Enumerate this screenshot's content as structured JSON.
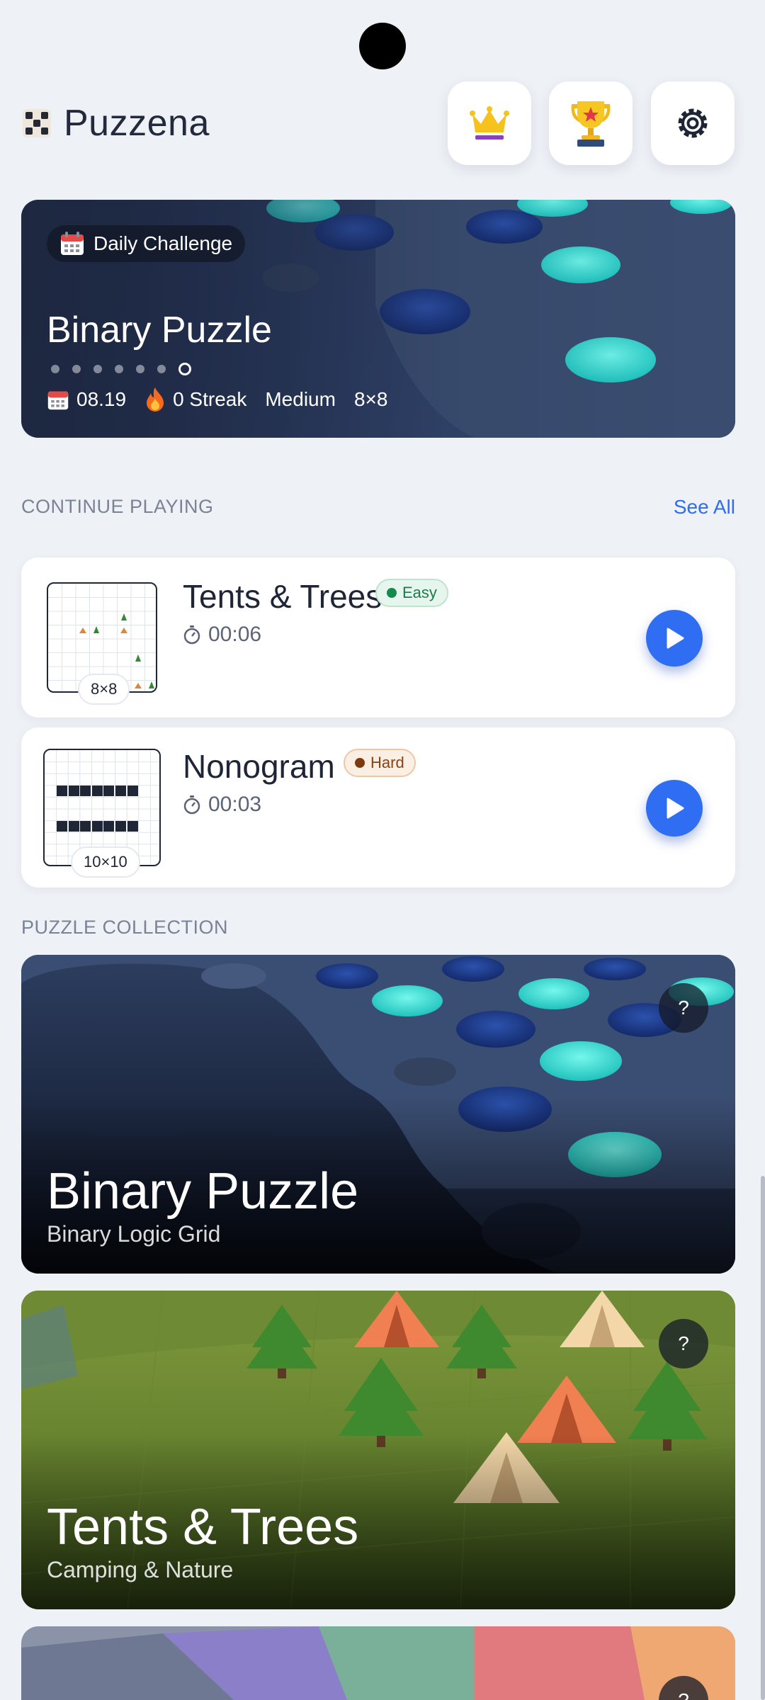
{
  "header": {
    "app_title": "Puzzena",
    "premium_icon": "crown-icon",
    "leaderboard_icon": "trophy-icon",
    "settings_icon": "gear-icon"
  },
  "daily_challenge": {
    "badge_label": "Daily Challenge",
    "puzzle_title": "Binary Puzzle",
    "carousel_count": 7,
    "carousel_active_index": 6,
    "date": "08.19",
    "streak": "0 Streak",
    "difficulty": "Medium",
    "grid_size": "8×8"
  },
  "continue_playing": {
    "heading": "CONTINUE PLAYING",
    "see_all": "See All",
    "items": [
      {
        "name": "Tents & Trees",
        "difficulty": "Easy",
        "time": "00:06",
        "size": "8×8"
      },
      {
        "name": "Nonogram",
        "difficulty": "Hard",
        "time": "00:03",
        "size": "10×10"
      }
    ]
  },
  "collection": {
    "heading": "PUZZLE COLLECTION",
    "help_label": "?",
    "items": [
      {
        "title": "Binary Puzzle",
        "subtitle": "Binary Logic Grid"
      },
      {
        "title": "Tents & Trees",
        "subtitle": "Camping & Nature"
      }
    ]
  },
  "colors": {
    "accent": "#2f6ef2",
    "background": "#eef2f7",
    "easy": "#148a4e",
    "hard": "#7d3a10"
  }
}
